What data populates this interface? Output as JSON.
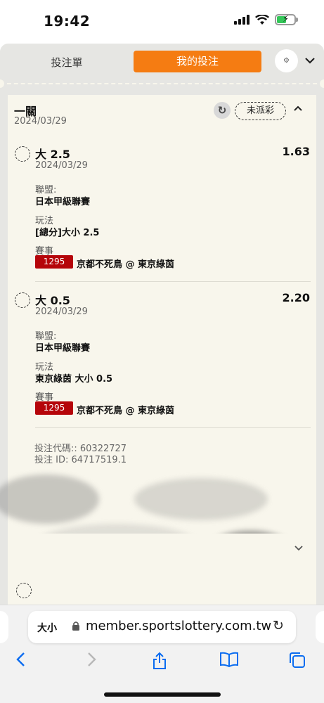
{
  "status_bar": {
    "time": "19:42"
  },
  "tabs": {
    "bet_slip": "投注單",
    "my_bets": "我的投注"
  },
  "card": {
    "title": "一關",
    "date": "2024/03/29",
    "status": "未派彩",
    "bets": [
      {
        "selection": "大 2.5",
        "odds": "1.63",
        "date": "2024/03/29",
        "league_label": "聯盟:",
        "league": "日本甲級聯賽",
        "market_label": "玩法",
        "market": "[總分]大小 2.5",
        "event_label": "賽事",
        "event_id": "1295",
        "match": "京都不死鳥 @ 東京綠茵"
      },
      {
        "selection": "大 0.5",
        "odds": "2.20",
        "date": "2024/03/29",
        "league_label": "聯盟:",
        "league": "日本甲級聯賽",
        "market_label": "玩法",
        "market": "東京綠茵 大小 0.5",
        "event_label": "賽事",
        "event_id": "1295",
        "match": "京都不死鳥 @ 東京綠茵"
      }
    ],
    "bet_code": "投注代碼:: 60322727",
    "bet_id": "投注 ID: 64717519.1"
  },
  "browser": {
    "text_size": "大小",
    "url": "member.sportslottery.com.tw"
  },
  "icons": {
    "gear": "settings-icon",
    "refresh": "refresh-icon",
    "lock": "lock-icon",
    "reload": "reload-icon",
    "back": "back-icon",
    "forward": "forward-icon",
    "share": "share-icon",
    "bookmarks": "bookmarks-icon",
    "tabs": "tabs-icon"
  },
  "colors": {
    "accent": "#f57c12",
    "event_badge": "#b5050a",
    "card_bg": "#f8f6ec",
    "link_blue": "#0a6cf0"
  }
}
